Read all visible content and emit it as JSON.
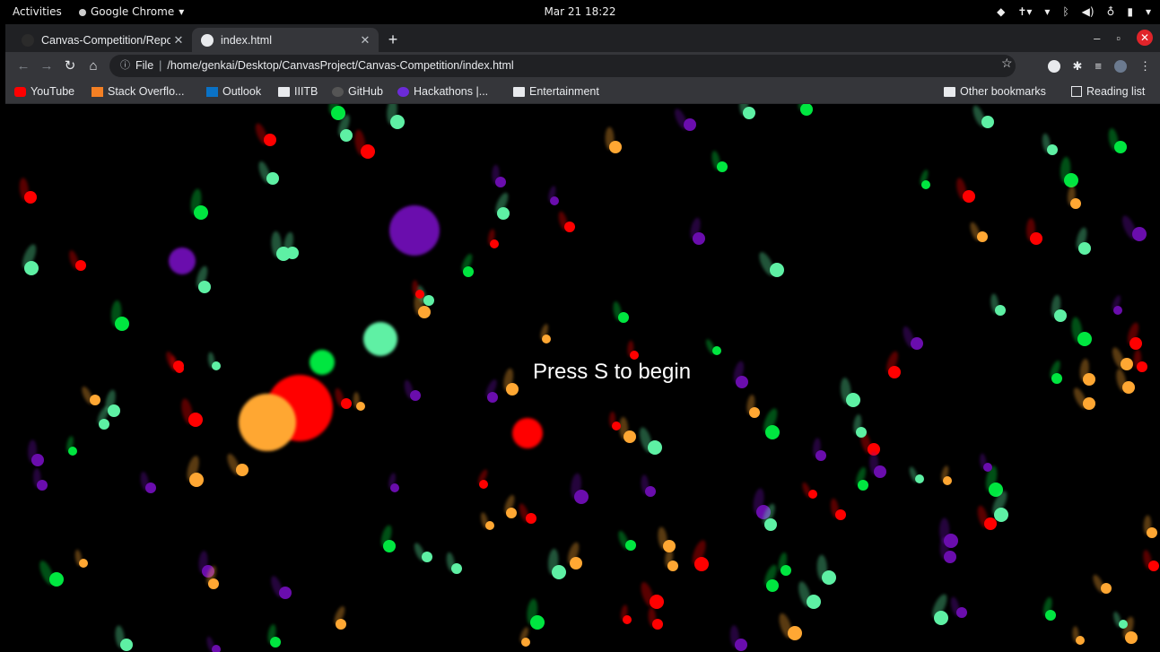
{
  "system_bar": {
    "activities": "Activities",
    "app_name": "Google Chrome",
    "clock": "Mar 21  18:22"
  },
  "tabs": [
    {
      "title": "Canvas-Competition/Repo",
      "active": false
    },
    {
      "title": "index.html",
      "active": true
    }
  ],
  "omnibox": {
    "scheme": "File",
    "path": "/home/genkai/Desktop/CanvasProject/Canvas-Competition/index.html"
  },
  "bookmarks": [
    {
      "label": "YouTube",
      "icon": "youtube-icon"
    },
    {
      "label": "Stack Overflo...",
      "icon": "stackoverflow-icon"
    },
    {
      "label": "Outlook",
      "icon": "outlook-icon"
    },
    {
      "label": "IIITB",
      "icon": "folder-icon"
    },
    {
      "label": "GitHub",
      "icon": "github-icon"
    },
    {
      "label": "Hackathons |...",
      "icon": "hackathons-icon"
    },
    {
      "label": "Entertainment",
      "icon": "folder-icon"
    }
  ],
  "other_bookmarks": "Other bookmarks",
  "reading_list": "Reading list",
  "page": {
    "prompt": "Press S to begin",
    "particle_colors": [
      "#ff0000",
      "#00e640",
      "#5ef0a4",
      "#ffa733",
      "#6a0dad"
    ]
  }
}
